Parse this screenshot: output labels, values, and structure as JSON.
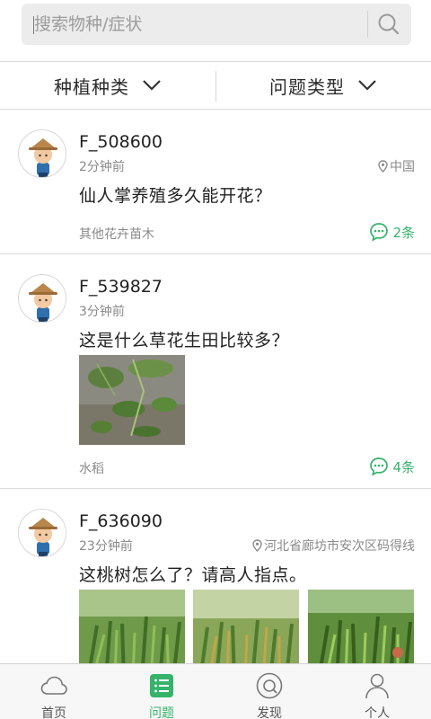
{
  "search": {
    "placeholder": "搜索物种/症状"
  },
  "filters": [
    {
      "label": "种植种类"
    },
    {
      "label": "问题类型"
    }
  ],
  "posts": [
    {
      "user": "F_508600",
      "time": "2分钟前",
      "location": "中国",
      "title": "仙人掌养殖多久能开花？",
      "tag": "其他花卉苗木",
      "comments": "2条"
    },
    {
      "user": "F_539827",
      "time": "3分钟前",
      "location": "",
      "title": "这是什么草花生田比较多？",
      "tag": "水稻",
      "comments": "4条"
    },
    {
      "user": "F_636090",
      "time": "23分钟前",
      "location": "河北省廊坊市安次区码得线",
      "title": "这桃树怎么了？请高人指点。",
      "tag": "",
      "comments": ""
    }
  ],
  "nav": [
    {
      "label": "首页",
      "icon": "cloud-icon"
    },
    {
      "label": "问题",
      "icon": "list-icon"
    },
    {
      "label": "发现",
      "icon": "discover-icon"
    },
    {
      "label": "个人",
      "icon": "person-icon"
    }
  ],
  "colors": {
    "accent": "#35b36b",
    "search_bg": "#ececec",
    "nav_bg": "#f7f7f7"
  }
}
